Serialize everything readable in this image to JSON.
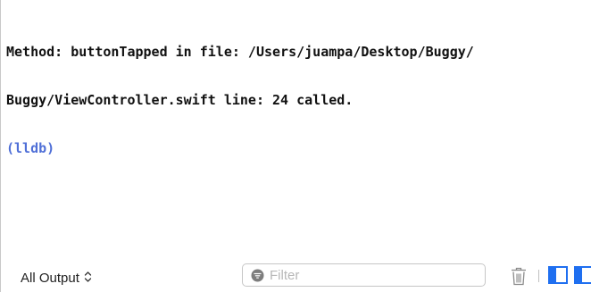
{
  "console": {
    "lines": [
      "Method: buttonTapped in file: /Users/juampa/Desktop/Buggy/",
      "Buggy/ViewController.swift line: 24 called."
    ],
    "prompt": "(lldb)"
  },
  "toolbar": {
    "output_selector": "All Output",
    "filter_placeholder": "Filter",
    "filter_value": ""
  },
  "colors": {
    "prompt": "#4f6fd7",
    "accent": "#1f6ff0"
  },
  "icons": [
    "updown-chevron-icon",
    "filter-icon",
    "trash-icon",
    "split-left-icon",
    "split-right-icon"
  ]
}
